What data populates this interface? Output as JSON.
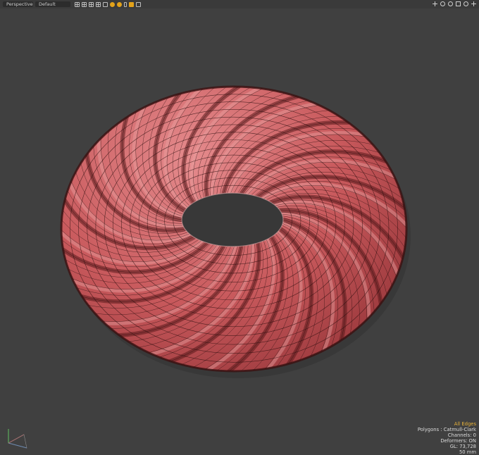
{
  "toolbar": {
    "view_mode": "Perspective",
    "shading_mode": "Default",
    "icons": [
      "grid-icon",
      "grid-icon",
      "grid-icon",
      "grid-icon",
      "square-icon",
      "highlight-icon",
      "highlight-icon",
      "wireframe-icon",
      "highlight-icon",
      "image-icon"
    ],
    "right_icons": [
      "move-view-icon",
      "rotate-view-icon",
      "zoom-view-icon",
      "maximize-icon",
      "settings-icon",
      "menu-icon"
    ]
  },
  "colors": {
    "viewport_bg": "#404040",
    "mesh_base": "#c8595c",
    "mesh_highlight": "#e9a0a0",
    "mesh_shadow": "#5a1a1c",
    "wire": "#2a0d0e",
    "accent": "#e8b23a"
  },
  "info": {
    "selection_mode": "All Edges",
    "polygons": "Polygons : Catmull-Clark",
    "channels": "Channels: 0",
    "deformers": "Deformers: ON",
    "gl": "GL: 73,728",
    "focal": "50 mm"
  }
}
